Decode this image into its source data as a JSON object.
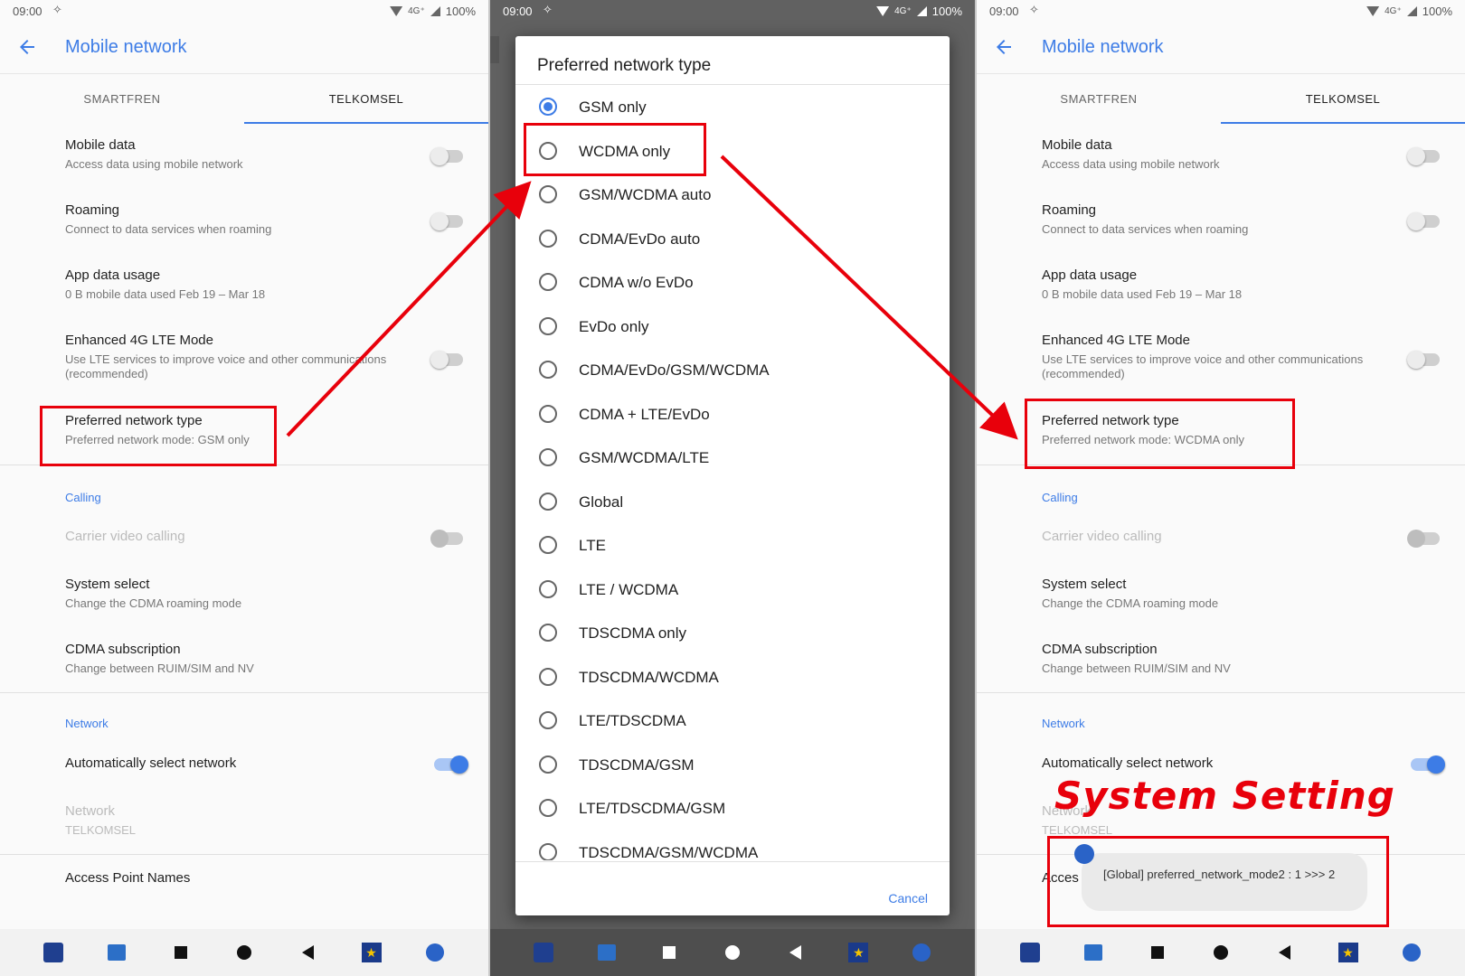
{
  "status": {
    "time": "09:00",
    "network": "4G⁺",
    "battery": "100%"
  },
  "left": {
    "title": "Mobile network",
    "tabs": [
      "SMARTFREN",
      "TELKOMSEL"
    ],
    "items": [
      {
        "title": "Mobile data",
        "summary": "Access data using mobile network"
      },
      {
        "title": "Roaming",
        "summary": "Connect to data services when roaming"
      },
      {
        "title": "App data usage",
        "summary": "0 B mobile data used Feb 19 – Mar 18"
      },
      {
        "title": "Enhanced 4G LTE Mode",
        "summary": "Use LTE services to improve voice and other communications (recommended)"
      },
      {
        "title": "Preferred network type",
        "summary": "Preferred network mode: GSM only"
      }
    ],
    "calling_header": "Calling",
    "carrier_video": "Carrier video calling",
    "system_select": {
      "title": "System select",
      "summary": "Change the CDMA roaming mode"
    },
    "cdma_sub": {
      "title": "CDMA subscription",
      "summary": "Change between RUIM/SIM and NV"
    },
    "network_header": "Network",
    "auto_select": "Automatically select network",
    "network": {
      "title": "Network",
      "summary": "TELKOMSEL"
    },
    "apn": "Access Point Names"
  },
  "dialog": {
    "title": "Preferred network type",
    "options": [
      "GSM only",
      "WCDMA only",
      "GSM/WCDMA auto",
      "CDMA/EvDo auto",
      "CDMA w/o EvDo",
      "EvDo only",
      "CDMA/EvDo/GSM/WCDMA",
      "CDMA + LTE/EvDo",
      "GSM/WCDMA/LTE",
      "Global",
      "LTE",
      "LTE / WCDMA",
      "TDSCDMA only",
      "TDSCDMA/WCDMA",
      "LTE/TDSCDMA",
      "TDSCDMA/GSM",
      "LTE/TDSCDMA/GSM",
      "TDSCDMA/GSM/WCDMA"
    ],
    "selected": "GSM only",
    "cancel": "Cancel"
  },
  "right": {
    "title": "Mobile network",
    "tabs": [
      "SMARTFREN",
      "TELKOMSEL"
    ],
    "items": [
      {
        "title": "Mobile data",
        "summary": "Access data using mobile network"
      },
      {
        "title": "Roaming",
        "summary": "Connect to data services when roaming"
      },
      {
        "title": "App data usage",
        "summary": "0 B mobile data used Feb 19 – Mar 18"
      },
      {
        "title": "Enhanced 4G LTE Mode",
        "summary": "Use LTE services to improve voice and other communications (recommended)"
      },
      {
        "title": "Preferred network type",
        "summary": "Preferred network mode: WCDMA only"
      }
    ],
    "calling_header": "Calling",
    "carrier_video": "Carrier video calling",
    "system_select": {
      "title": "System select",
      "summary": "Change the CDMA roaming mode"
    },
    "cdma_sub": {
      "title": "CDMA subscription",
      "summary": "Change between RUIM/SIM and NV"
    },
    "network_header": "Network",
    "auto_select": "Automatically select network",
    "network": {
      "title": "Network",
      "summary": "TELKOMSEL"
    },
    "apn": "Acces",
    "toast": "[Global] preferred_network_mode2 : 1 >>> 2"
  },
  "annotation": {
    "label": "System Setting",
    "color": "#e8000b"
  },
  "colors": {
    "accent": "#3d7ce6",
    "annotation": "#e8000b"
  }
}
